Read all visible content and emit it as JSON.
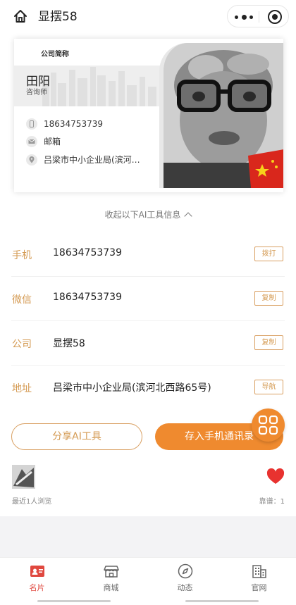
{
  "nav": {
    "title": "显摆58"
  },
  "card": {
    "company": "公司简称",
    "name": "田阳",
    "role": "咨询师",
    "phone": "18634753739",
    "email": "邮箱",
    "address": "吕梁市中小企业局(滨河…"
  },
  "toggle": {
    "label": "收起以下AI工具信息"
  },
  "rows": [
    {
      "label": "手机",
      "value": "18634753739",
      "action": "拨打"
    },
    {
      "label": "微信",
      "value": "18634753739",
      "action": "复制"
    },
    {
      "label": "公司",
      "value": "显摆58",
      "action": "复制"
    },
    {
      "label": "地址",
      "value": "吕梁市中小企业局(滨河北西路65号)",
      "action": "导航"
    }
  ],
  "buttons": {
    "share": "分享AI工具",
    "save": "存入手机通讯录"
  },
  "visitors": {
    "recent": "最近1人浏览",
    "likes": "靠谱：1"
  },
  "tabs": [
    {
      "label": "名片",
      "icon": "card-icon",
      "active": true
    },
    {
      "label": "商城",
      "icon": "shop-icon",
      "active": false
    },
    {
      "label": "动态",
      "icon": "compass-icon",
      "active": false
    },
    {
      "label": "官网",
      "icon": "building-icon",
      "active": false
    }
  ],
  "colors": {
    "accent": "#d49a52",
    "primary_orange": "#ef8a2f",
    "tab_active": "#e0483f",
    "heart": "#e8322f"
  }
}
